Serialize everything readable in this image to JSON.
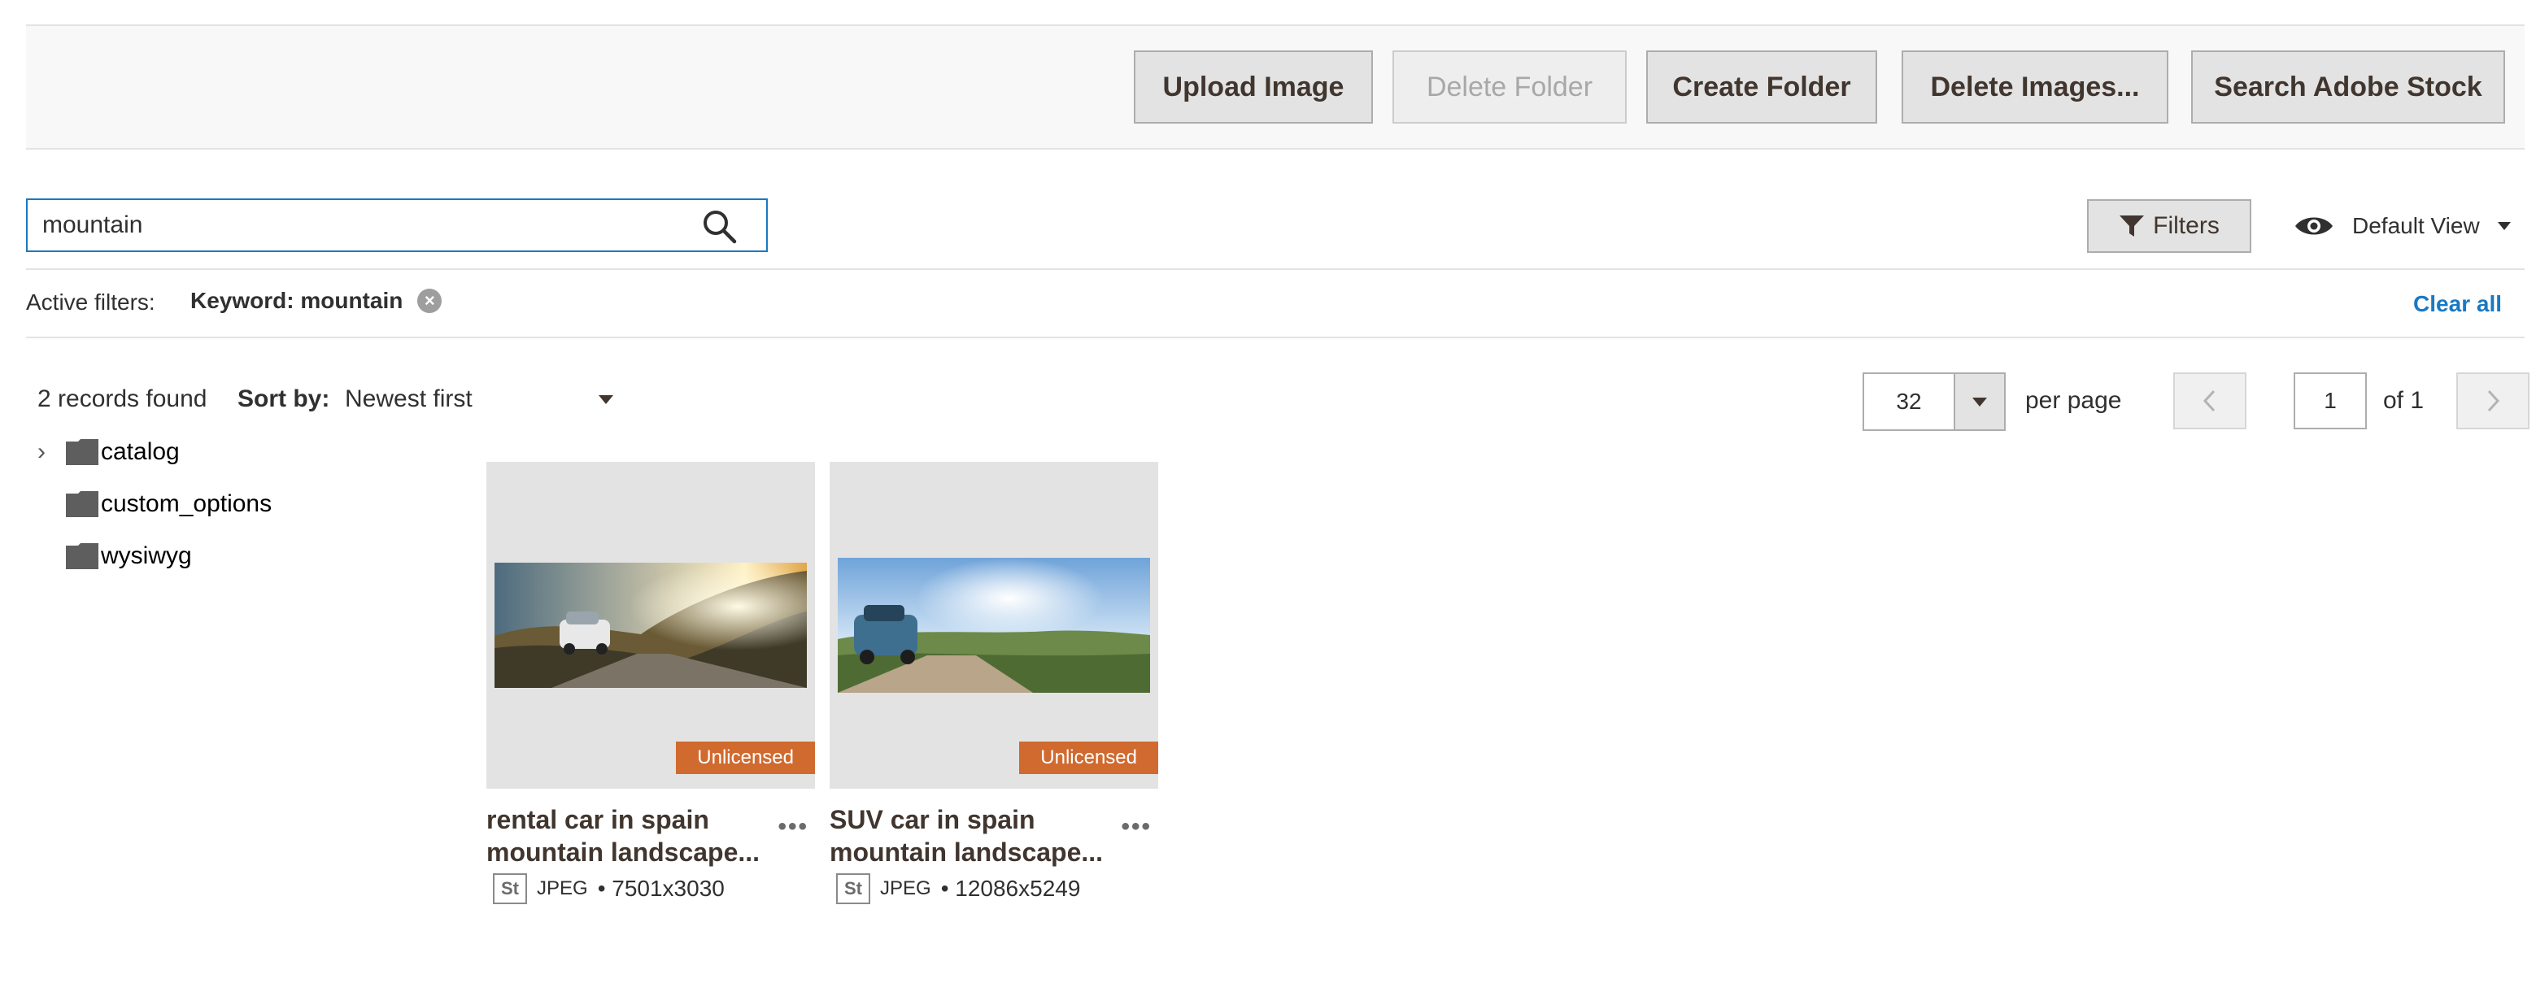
{
  "toolbar": {
    "upload_image": "Upload Image",
    "delete_folder": "Delete Folder",
    "create_folder": "Create Folder",
    "delete_images": "Delete Images...",
    "search_adobe_stock": "Search Adobe Stock"
  },
  "search": {
    "value": "mountain",
    "icon": "search-icon"
  },
  "filters_button": {
    "label": "Filters",
    "icon": "funnel-icon"
  },
  "view_switch": {
    "label": "Default View",
    "icon": "eye-icon"
  },
  "active_filters": {
    "label": "Active filters:",
    "chips": [
      {
        "label": "Keyword: mountain"
      }
    ],
    "clear_all": "Clear all"
  },
  "results": {
    "records_found": "2 records found",
    "sort_label": "Sort by:",
    "sort_value": "Newest first"
  },
  "pagination": {
    "per_page_value": "32",
    "per_page_label": "per page",
    "current_page": "1",
    "of_pages": "of 1"
  },
  "folders": [
    {
      "name": "catalog",
      "expandable": true
    },
    {
      "name": "custom_options",
      "expandable": false
    },
    {
      "name": "wysiwyg",
      "expandable": false
    }
  ],
  "images": [
    {
      "title_line1": "rental car in spain",
      "title_line2": "mountain landscape...",
      "format": "JPEG",
      "dimensions": "• 7501x3030",
      "badge": "Unlicensed",
      "source_icon": "St"
    },
    {
      "title_line1": "SUV car in spain",
      "title_line2": "mountain landscape...",
      "format": "JPEG",
      "dimensions": "• 12086x5249",
      "badge": "Unlicensed",
      "source_icon": "St"
    }
  ],
  "colors": {
    "accent": "#1979c3",
    "badge": "#d16a2f",
    "button_bg": "#e3e3e3",
    "toolbar_bg": "#f8f8f8"
  }
}
